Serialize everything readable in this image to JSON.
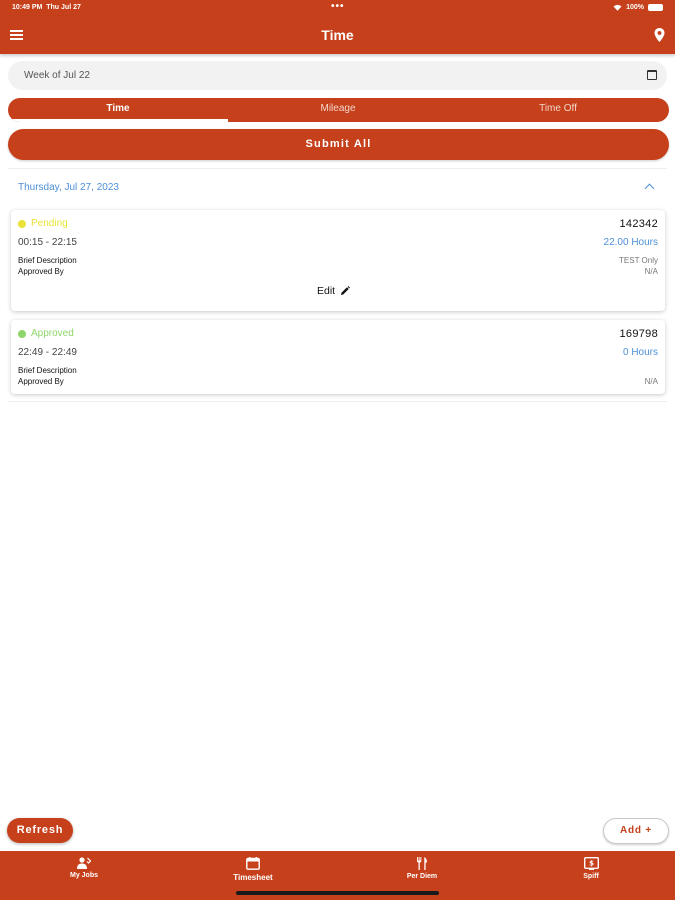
{
  "status_bar": {
    "time": "10:49 PM",
    "date": "Thu Jul 27",
    "dots": "•••",
    "battery": "100%"
  },
  "app_bar": {
    "title": "Time"
  },
  "week_selector": {
    "label": "Week of Jul 22"
  },
  "tabs": [
    {
      "label": "Time",
      "active": true
    },
    {
      "label": "Mileage",
      "active": false
    },
    {
      "label": "Time Off",
      "active": false
    }
  ],
  "submit_all_label": "Submit All",
  "date_group": {
    "date": "Thursday, Jul 27, 2023"
  },
  "entries": [
    {
      "status": "Pending",
      "status_color": "#e8e336",
      "id": "142342",
      "time_range": "00:15 - 22:15",
      "hours": "22.00 Hours",
      "brief_description_label": "Brief Description",
      "brief_description_value": "TEST Only",
      "approved_by_label": "Approved By",
      "approved_by_value": "N/A",
      "edit_label": "Edit"
    },
    {
      "status": "Approved",
      "status_color": "#8ed66b",
      "id": "169798",
      "time_range": "22:49 - 22:49",
      "hours": "0 Hours",
      "brief_description_label": "Brief Description",
      "brief_description_value": "",
      "approved_by_label": "Approved By",
      "approved_by_value": "N/A"
    }
  ],
  "refresh_label": "Refresh",
  "add_label": "Add +",
  "bottom_nav": [
    {
      "label": "My Jobs",
      "icon": "jobs-icon",
      "active": false
    },
    {
      "label": "Timesheet",
      "icon": "timesheet-icon",
      "active": true
    },
    {
      "label": "Per Diem",
      "icon": "per-diem-icon",
      "active": false
    },
    {
      "label": "Spiff",
      "icon": "spiff-icon",
      "active": false
    }
  ],
  "colors": {
    "primary": "#c5401b",
    "link": "#4d8fd6",
    "pending": "#e8e336",
    "approved": "#8ed66b"
  }
}
